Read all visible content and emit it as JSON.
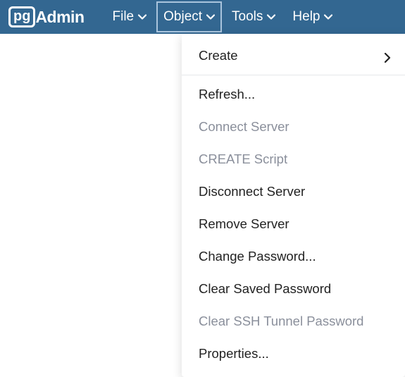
{
  "brand": {
    "box": "pg",
    "name": "Admin"
  },
  "menubar": {
    "items": [
      {
        "label": "File"
      },
      {
        "label": "Object"
      },
      {
        "label": "Tools"
      },
      {
        "label": "Help"
      }
    ],
    "active_index": 1
  },
  "dropdown": {
    "items": [
      {
        "label": "Create",
        "submenu": true,
        "disabled": false
      },
      {
        "divider": true
      },
      {
        "label": "Refresh...",
        "disabled": false
      },
      {
        "label": "Connect Server",
        "disabled": true
      },
      {
        "label": "CREATE Script",
        "disabled": true
      },
      {
        "label": "Disconnect Server",
        "disabled": false
      },
      {
        "label": "Remove Server",
        "disabled": false
      },
      {
        "label": "Change Password...",
        "disabled": false
      },
      {
        "label": "Clear Saved Password",
        "disabled": false
      },
      {
        "label": "Clear SSH Tunnel Password",
        "disabled": true
      },
      {
        "label": "Properties...",
        "disabled": false
      }
    ]
  }
}
